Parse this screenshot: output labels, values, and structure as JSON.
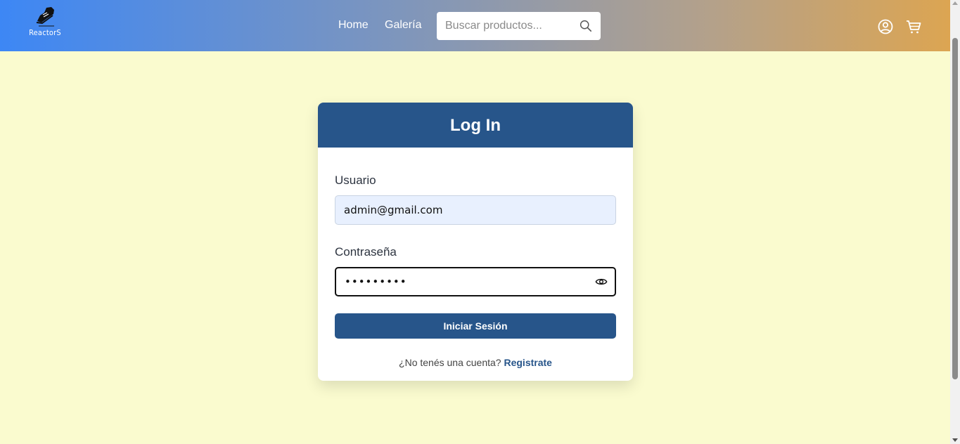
{
  "navbar": {
    "logo_text": "ReactorS",
    "links": {
      "home": "Home",
      "gallery": "Galería"
    },
    "search": {
      "placeholder": "Buscar productos..."
    },
    "icons": {
      "search": "search-icon",
      "user": "user-icon",
      "cart": "cart-icon"
    }
  },
  "login": {
    "title": "Log In",
    "username_label": "Usuario",
    "username_value": "admin@gmail.com",
    "password_label": "Contraseña",
    "password_value": "•••••••••",
    "submit_label": "Iniciar Sesión",
    "no_account_text": "¿No tenés una cuenta?",
    "register_link": "Registrate"
  },
  "colors": {
    "page_background": "#fafbcf",
    "primary": "#27558a",
    "navbar_gradient_start": "#3d87f5",
    "navbar_gradient_end": "#dca552"
  }
}
